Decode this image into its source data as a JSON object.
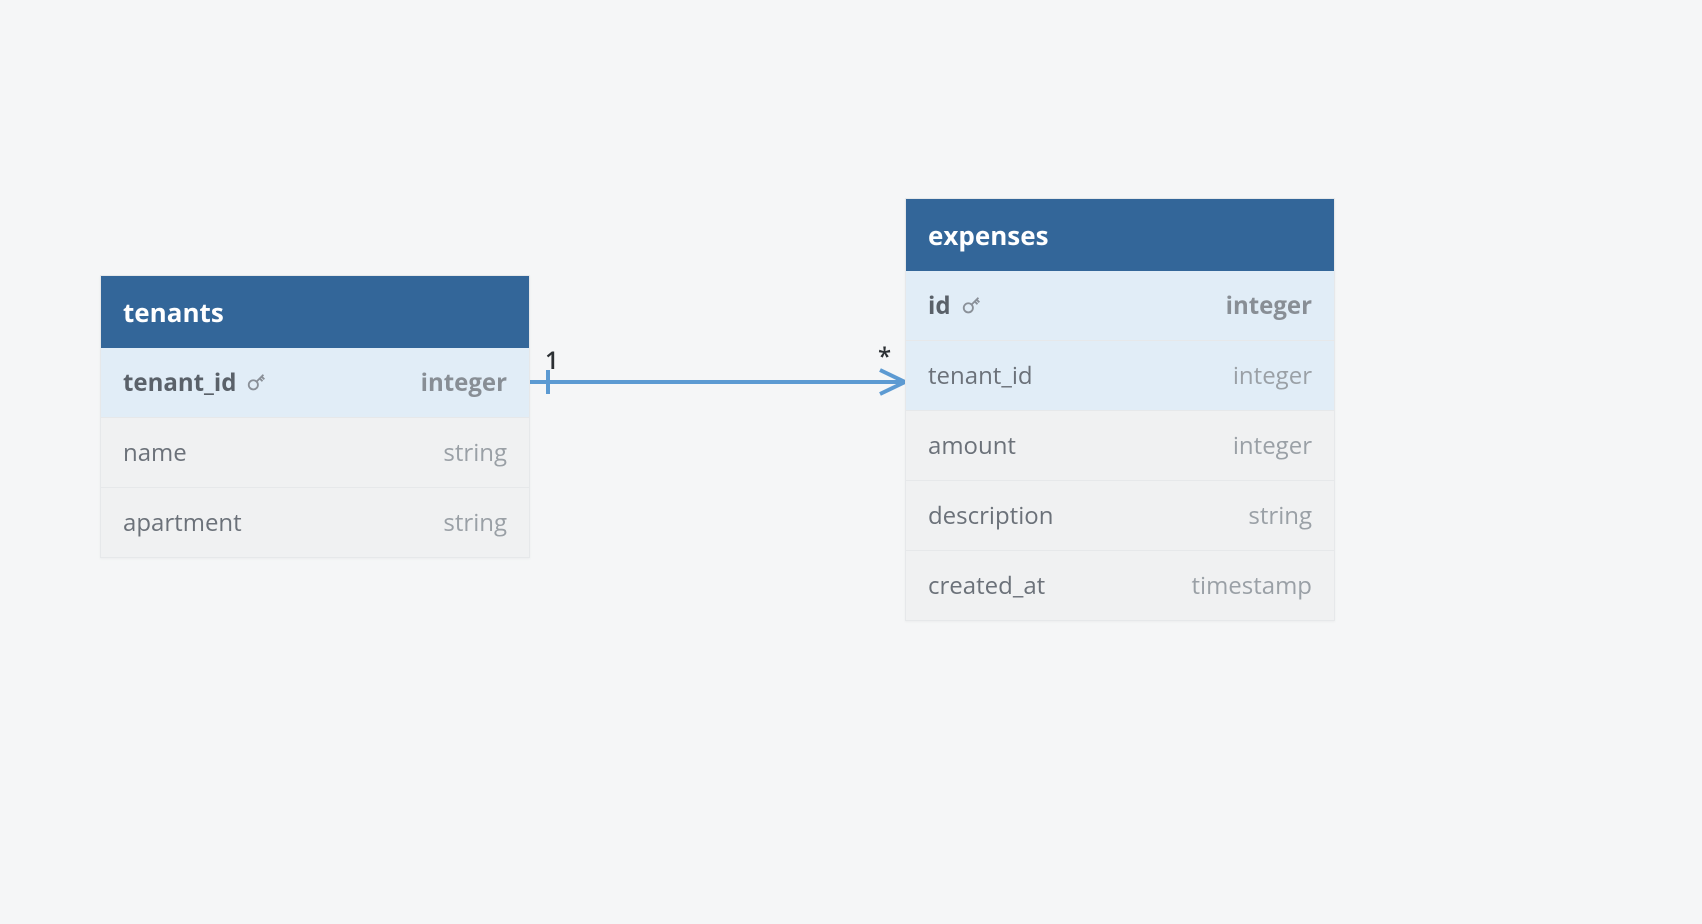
{
  "diagram": {
    "type": "er-diagram",
    "entities": {
      "tenants": {
        "name": "tenants",
        "columns": [
          {
            "name": "tenant_id",
            "type": "integer",
            "pk": true
          },
          {
            "name": "name",
            "type": "string"
          },
          {
            "name": "apartment",
            "type": "string"
          }
        ]
      },
      "expenses": {
        "name": "expenses",
        "columns": [
          {
            "name": "id",
            "type": "integer",
            "pk": true
          },
          {
            "name": "tenant_id",
            "type": "integer",
            "fk": true
          },
          {
            "name": "amount",
            "type": "integer"
          },
          {
            "name": "description",
            "type": "string"
          },
          {
            "name": "created_at",
            "type": "timestamp"
          }
        ]
      }
    },
    "relationship": {
      "from": {
        "entity": "tenants",
        "column": "tenant_id",
        "cardinality": "1"
      },
      "to": {
        "entity": "expenses",
        "column": "tenant_id",
        "cardinality": "*"
      }
    }
  }
}
